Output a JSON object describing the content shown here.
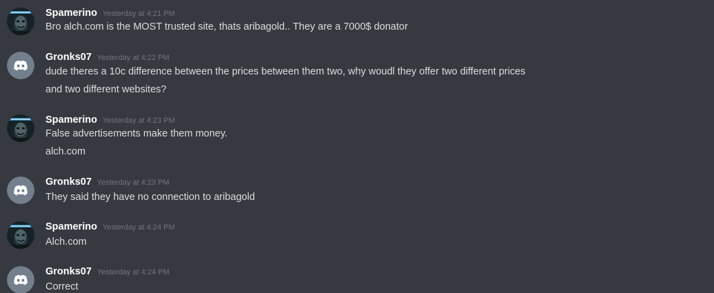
{
  "colors": {
    "background": "#36393f",
    "username": "#ffffff",
    "timestamp": "#72767d",
    "message_text": "#dcddde",
    "discord_avatar_bg": "#747f8d"
  },
  "messages": [
    {
      "author": "Spamerino",
      "timestamp": "Yesterday at 4:21 PM",
      "avatar_icon": "masked-user-avatar",
      "lines": [
        "Bro alch.com is the MOST trusted site, thats aribagold.. They are a 7000$ donator"
      ]
    },
    {
      "author": "Gronks07",
      "timestamp": "Yesterday at 4:22 PM",
      "avatar_icon": "discord-default-avatar",
      "lines": [
        "dude theres a 10c difference between the prices between them two, why woudl they offer two different prices",
        "and two different websites?"
      ]
    },
    {
      "author": "Spamerino",
      "timestamp": "Yesterday at 4:23 PM",
      "avatar_icon": "masked-user-avatar",
      "lines": [
        "False advertisements make them money.",
        "alch.com"
      ]
    },
    {
      "author": "Gronks07",
      "timestamp": "Yesterday at 4:23 PM",
      "avatar_icon": "discord-default-avatar",
      "lines": [
        "They said they have no connection to aribagold"
      ]
    },
    {
      "author": "Spamerino",
      "timestamp": "Yesterday at 4:24 PM",
      "avatar_icon": "masked-user-avatar",
      "lines": [
        "Alch.com"
      ]
    },
    {
      "author": "Gronks07",
      "timestamp": "Yesterday at 4:24 PM",
      "avatar_icon": "discord-default-avatar",
      "lines": [
        "Correct"
      ]
    }
  ]
}
